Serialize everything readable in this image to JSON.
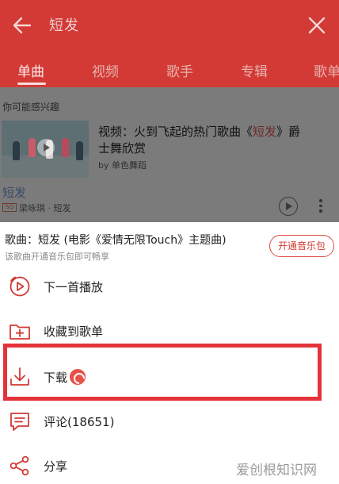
{
  "header": {
    "search_query": "短发",
    "tabs": [
      {
        "label": "单曲",
        "active": true
      },
      {
        "label": "视频",
        "active": false
      },
      {
        "label": "歌手",
        "active": false
      },
      {
        "label": "专辑",
        "active": false
      },
      {
        "label": "歌单",
        "active": false
      }
    ],
    "icons": {
      "back": "arrow-left-icon",
      "clear": "close-icon"
    },
    "accent_color": "#d33a35"
  },
  "content": {
    "suggest_title": "你可能感兴趣",
    "video": {
      "title_prefix": "视频：火到飞起的热门歌曲《",
      "title_highlight": "短发",
      "title_suffix": "》爵士舞欣赏",
      "byline": "by 单色舞蹈"
    },
    "song": {
      "name": "短发",
      "quality_badge": "SQ",
      "artist": "梁咏琪 · 短发"
    }
  },
  "sheet": {
    "title": "歌曲：短发 (电影《爱情无限Touch》主题曲)",
    "note": "该歌曲开通音乐包即可畅享",
    "vip_button": "开通音乐包",
    "items": [
      {
        "label": "下一首播放",
        "icon": "play-next-icon"
      },
      {
        "label": "收藏到歌单",
        "icon": "add-to-playlist-icon"
      },
      {
        "label": "下载",
        "icon": "download-icon"
      },
      {
        "label": "评论(18651)",
        "icon": "comment-icon"
      },
      {
        "label": "分享",
        "icon": "share-icon"
      }
    ]
  },
  "watermark": "爱创根知识网"
}
